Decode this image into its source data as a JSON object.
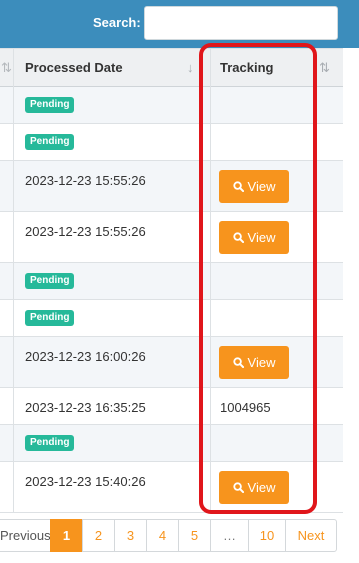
{
  "search": {
    "label": "Search:",
    "value": ""
  },
  "table": {
    "headers": {
      "date": "Processed Date",
      "tracking": "Tracking"
    },
    "rows": [
      {
        "status": "Pending",
        "date": "",
        "tracking": ""
      },
      {
        "status": "Pending",
        "date": "",
        "tracking": ""
      },
      {
        "status": "",
        "date": "2023-12-23 15:55:26",
        "view": "View"
      },
      {
        "status": "",
        "date": "2023-12-23 15:55:26",
        "view": "View"
      },
      {
        "status": "Pending",
        "date": "",
        "tracking": ""
      },
      {
        "status": "Pending",
        "date": "",
        "tracking": ""
      },
      {
        "status": "",
        "date": "2023-12-23 16:00:26",
        "view": "View"
      },
      {
        "status": "",
        "date": "2023-12-23 16:35:25",
        "tracking": "1004965"
      },
      {
        "status": "Pending",
        "date": "",
        "tracking": ""
      },
      {
        "status": "",
        "date": "2023-12-23 15:40:26",
        "view": "View"
      }
    ]
  },
  "pagination": {
    "prev": "Previous",
    "pages": [
      "1",
      "2",
      "3",
      "4",
      "5",
      "…",
      "10"
    ],
    "active": "1",
    "next": "Next"
  },
  "colors": {
    "accent": "#f7941d",
    "badge": "#26b99a",
    "header_bar": "#3c8dbc",
    "highlight": "#e0161b"
  },
  "icons": {
    "view": "search-icon",
    "sort": "sort-icon"
  }
}
